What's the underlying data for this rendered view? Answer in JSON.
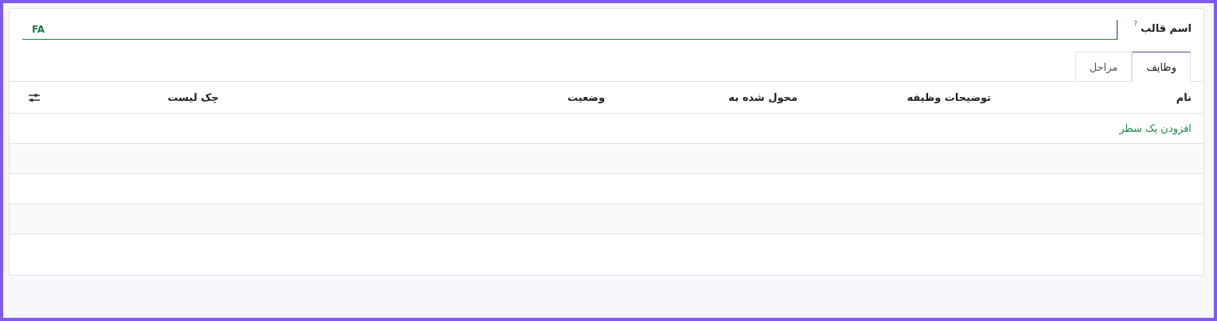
{
  "field": {
    "label": "اسم قالب",
    "help": "?",
    "value": "FA"
  },
  "tabs": [
    {
      "label": "وظایف",
      "selected": true
    },
    {
      "label": "مراحل",
      "selected": false
    }
  ],
  "table": {
    "columns": [
      "نام",
      "توضیحات وظیفه",
      "محول شده به",
      "وضعیت",
      "چک لیست"
    ],
    "add_line": "افزودن یک سطر"
  }
}
